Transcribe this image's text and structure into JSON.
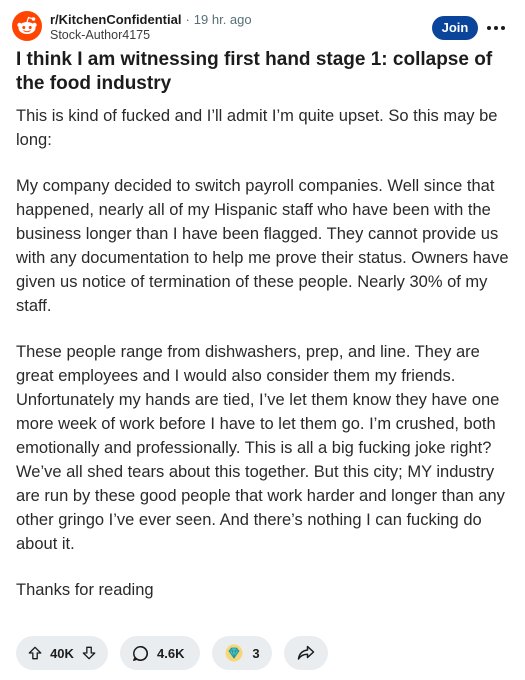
{
  "post": {
    "subreddit": "r/KitchenConfidential",
    "separator": "·",
    "time_ago": "19 hr. ago",
    "author": "Stock-Author4175",
    "join_label": "Join",
    "title": "I think I am witnessing first hand stage 1: collapse of the food industry",
    "paragraphs": [
      "This is kind of fucked and I’ll admit I’m quite upset. So this may be long:",
      "My company decided to switch payroll companies. Well since that happened, nearly all of my Hispanic staff who have been with the business longer than I have been flagged. They cannot provide us with any documentation to help me prove their status. Owners have given us notice of termination of these people. Nearly 30% of my staff.",
      "These people range from dishwashers, prep, and line. They are great employees and I would also consider them my friends. Unfortunately my hands are tied, I’ve let them know they have one more week of work before I have to let them go. I’m crushed, both emotionally and professionally. This is all a big fucking joke right? We’ve all shed tears about this together. But this city; MY industry are run by these good people that work harder and longer than any other gringo I’ve ever seen. And there’s nothing I can fucking do about it.",
      "Thanks for reading"
    ]
  },
  "actions": {
    "votes": "40K",
    "comments": "4.6K",
    "awards": "3"
  },
  "icons": {
    "avatar": "reddit-snoo-icon",
    "more": "more-horizontal-icon",
    "upvote": "upvote-arrow-icon",
    "downvote": "downvote-arrow-icon",
    "comment": "comment-bubble-icon",
    "award": "award-gem-icon",
    "share": "share-arrow-icon"
  },
  "colors": {
    "join_button": "#0a449b",
    "action_pill": "#eaedef",
    "avatar": "#ff4500"
  }
}
